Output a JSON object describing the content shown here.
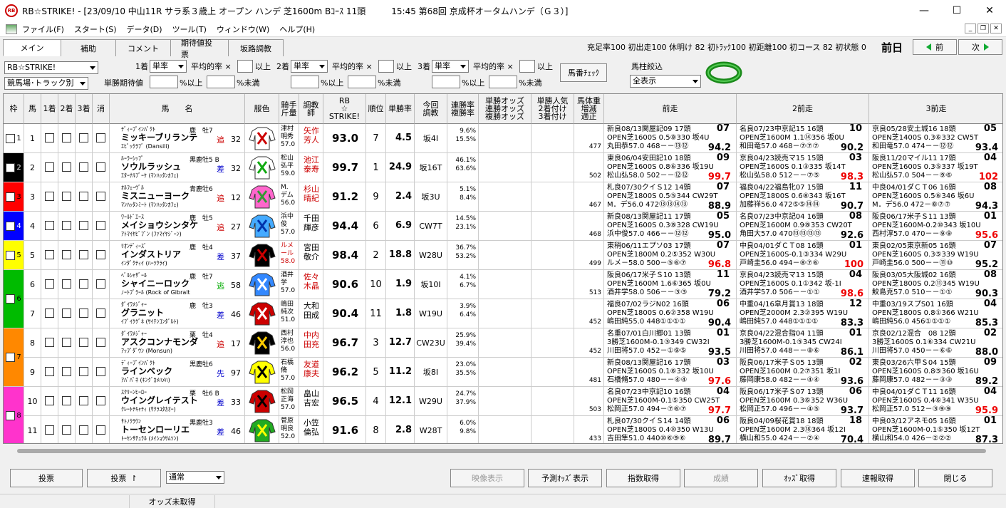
{
  "window": {
    "title": "RB☆STRIKE! - [23/09/10 中山11R サラ系３歳上 オープン ハンデ 芝1600m Bｺｰｽ 11頭　　　15:45 第68回 京成杯オータムハンデ（Ｇ３）]",
    "icon_text": "RB"
  },
  "menu": [
    "ファイル(F)",
    "スタート(S)",
    "データ(D)",
    "ツール(T)",
    "ウィンドウ(W)",
    "ヘルプ(H)"
  ],
  "tabs": [
    "メイン",
    "補助",
    "コメント",
    "期待値投票",
    "坂路調教"
  ],
  "stats": "充足率100 初出走100 休明け 82 初ﾄﾗｯｸ100 初距離100 初コース 82 初状態  0",
  "nav": {
    "day": "前日",
    "prev": "前",
    "next": "次"
  },
  "filters": {
    "app_select": "RB☆STRIKE!",
    "track_select": "競馬場･トラック別",
    "place1": "1着",
    "place2": "2着",
    "place3": "3着",
    "type": "単率",
    "avg": "平均的率 ×",
    "above": "以上",
    "expect": "単勝期待値",
    "pct_above": "%以上",
    "pct_below": "%未満",
    "umaban_btn": "馬番ﾁｪｯｸ",
    "filter_label": "馬柱絞込",
    "filter_value": "全表示"
  },
  "headers": {
    "waku": "枠",
    "uma": "馬",
    "p1": "1着",
    "p2": "2着",
    "p3": "3着",
    "del": "消",
    "name": "馬　　名",
    "silks": "服色",
    "jockey": "騎手\n斤量",
    "trainer": "調教\n師",
    "rb": "RB\n☆\nSTRIKE!",
    "rank": "順位",
    "win": "単勝率",
    "training": "今回\n調教",
    "rate": "連勝率\n複勝率",
    "odds": "単勝オッズ\n連勝オッズ\n複勝オッズ",
    "pop": "単勝人気\n2着付け\n3着付け",
    "weight": "馬体重\n増減\n適正",
    "r1": "前走",
    "r2": "2前走",
    "r3": "3前走"
  },
  "horses": [
    {
      "waku": "1",
      "num": "1",
      "sire": "ﾃﾞｨｰﾌﾟｲﾝﾊﾟｸﾄ",
      "sexage": "鹿　牡7",
      "name": "ミッキーブリランテ",
      "dam": "ｴﾋﾟｯｸﾗﾌﾞ (Dansili)",
      "style": "追",
      "pts": "32",
      "jockey": "津村\n明秀\n57.0",
      "trainer": "矢作\n芳人",
      "rb": "93.0",
      "rank": "7",
      "win": "4.5",
      "train": "坂4I",
      "r1": "9.6%",
      "r2": "15.5%",
      "w": "477",
      "races": [
        {
          "l1": "新良08/13関屋記09 17頭",
          "rk": "07",
          "l2": "OPEN芝1600S 0.5⑧330 坂4U",
          "l3": "丸田恭57.0 468－－⑬⑫",
          "ix": "94.2",
          "red": false
        },
        {
          "l1": "名良07/23中京記15 16頭",
          "rk": "10",
          "l2": "OPEN芝1600M 1.1⑭356 坂0U",
          "l3": "和田竜57.0 468－⑦⑦⑦",
          "ix": "90.2",
          "red": false
        },
        {
          "l1": "京良05/28安土城16 18頭",
          "rk": "05",
          "l2": "OPEN芝1400S 0.3⑥332 CW5T",
          "l3": "和田竜57.0 474－－⑫⑫",
          "ix": "93.4",
          "red": false
        }
      ]
    },
    {
      "waku": "2",
      "num": "2",
      "sire": "ﾙｰﾗｰｼｯﾌﾟ",
      "sexage": "黒鹿牡5 B",
      "name": "ソウルラッシュ",
      "dam": "ｴﾀｰﾅﾙﾌﾞｰｹ (ﾏﾝﾊｯﾀﾝｶﾌｪ)",
      "style": "差",
      "pts": "32",
      "jockey": "松山\n弘平\n59.0",
      "trainer": "池江\n泰寿",
      "rb": "99.7",
      "rank": "1",
      "win": "24.9",
      "train": "坂16T",
      "r1": "46.1%",
      "r2": "63.6%",
      "w": "502",
      "races": [
        {
          "l1": "東良06/04安田記10 18頭",
          "rk": "09",
          "l2": "OPEN芝1600S 0.8⑥336 坂19U",
          "l3": "松山弘58.0 502－－⑫⑫",
          "ix": "99.7",
          "red": true
        },
        {
          "l1": "京良04/23読売マ15 15頭",
          "rk": "03",
          "l2": "OPEN芝1600S 0.1③335 坂14T",
          "l3": "松山弘58.0 512－－⑦⑤",
          "ix": "98.3",
          "red": true
        },
        {
          "l1": "阪良11/20マイル11 17頭",
          "rk": "04",
          "l2": "OPEN芝1600S 0.3⑤337 坂19T",
          "l3": "松山弘57.0 504－－⑨⑥",
          "ix": "102",
          "red": true
        }
      ]
    },
    {
      "waku": "3",
      "num": "3",
      "sire": "ｵﾙﾌｪｰｳﾞﾙ",
      "sexage": "青鹿牡6",
      "name": "ミスニューヨーク",
      "dam": "ﾏﾝﾊｯﾀﾝﾐｰﾄ (ﾏﾝﾊｯﾀﾝｶﾌｪ)",
      "style": "追",
      "pts": "12",
      "jockey": "M.\nデム\n56.0",
      "trainer": "杉山\n晴紀",
      "rb": "91.2",
      "rank": "9",
      "win": "2.4",
      "train": "坂3U",
      "r1": "5.1%",
      "r2": "8.4%",
      "w": "467",
      "races": [
        {
          "l1": "札良07/30クイＳ12 14頭",
          "rk": "07",
          "l2": "OPEN芝1800S 0.5⑤344 CW29T",
          "l3": "M．デ56.0 472⑬⑬⑭⑬",
          "ix": "88.9",
          "red": false
        },
        {
          "l1": "福良04/22福島牝07 15頭",
          "rk": "11",
          "l2": "OPEN芝1800S 0.6⑧343 坂16T",
          "l3": "加藤祥56.0 472⑤⑤⑭⑭",
          "ix": "90.7",
          "red": false
        },
        {
          "l1": "中良04/01ダＣＴ06 16頭",
          "rk": "08",
          "l2": "OPEN芝1600S 0.5⑥346 坂6U",
          "l3": "M．デ56.0 472－⑧⑦⑦",
          "ix": "94.3",
          "red": false
        }
      ]
    },
    {
      "waku": "4",
      "num": "4",
      "sire": "ﾜｰﾙﾄﾞｴｰｽ",
      "sexage": "鹿　牡5",
      "name": "メイショウシンタケ",
      "dam": "ｱﾄﾏｲﾔﾋﾞﾌﾟﾝ (ﾌｧﾏｲﾔｼﾞｰﾝ)",
      "style": "追",
      "pts": "27",
      "jockey": "浜中\n俊\n57.0",
      "trainer": "千田\n輝彦",
      "rb": "94.4",
      "rank": "6",
      "win": "6.9",
      "train": "CW7T",
      "r1": "14.5%",
      "r2": "23.1%",
      "w": "468",
      "races": [
        {
          "l1": "新良08/13関屋記11 17頭",
          "rk": "05",
          "l2": "OPEN芝1600S 0.3⑧328 CW19U",
          "l3": "浜中俊57.0 466－－⑫⑫",
          "ix": "95.0",
          "red": false
        },
        {
          "l1": "名良07/23中京記04 16頭",
          "rk": "08",
          "l2": "OPEN芝1600M 0.9⑧353 CW20T",
          "l3": "角田大57.0 470⑬⑬⑬⑬",
          "ix": "92.6",
          "red": false
        },
        {
          "l1": "阪良06/17米子Ｓ11 13頭",
          "rk": "01",
          "l2": "OPEN芝1600M-0.2⑩343 坂10U",
          "l3": "西村淳57.0 470－－⑨⑨",
          "ix": "95.6",
          "red": true
        }
      ]
    },
    {
      "waku": "5",
      "num": "5",
      "sire": "ﾘｵﾝﾃﾞｨｰｽﾞ",
      "sexage": "鹿　牡4",
      "name": "インダストリア",
      "dam": "ｲﾝﾀﾞｸﾃｨｲ (ﾊｰﾂｸﾗｲ)",
      "style": "差",
      "pts": "37",
      "jockey": "ルメ\nール\n58.0",
      "trainer": "宮田\n敬介",
      "rb": "98.4",
      "rank": "2",
      "win": "18.8",
      "train": "W28U",
      "r1": "36.7%",
      "r2": "53.2%",
      "w": "499",
      "races": [
        {
          "l1": "東稍06/11エプソ03 17頭",
          "rk": "07",
          "l2": "OPEN芝1800M 0.2⑤352 W30U",
          "l3": "ルメ－58.0 500－⑤⑥⑦",
          "ix": "96.8",
          "red": true
        },
        {
          "l1": "中良04/01ダＣＴ08 16頭",
          "rk": "01",
          "l2": "OPEN芝1600S-0.1③334 W29U",
          "l3": "戸崎圭56.0 494－⑧⑦⑥",
          "ix": "100",
          "red": true
        },
        {
          "l1": "東良02/05東京新05 16頭",
          "rk": "07",
          "l2": "OPEN芝1600S 0.3⑤339 W19U",
          "l3": "戸崎圭56.0 500－－⑪⑩",
          "ix": "95.2",
          "red": false
        }
      ]
    },
    {
      "waku": "6",
      "num": "6",
      "sire": "ﾍﾞﾙｼｬｻﾞｰﾙ",
      "sexage": "鹿　牡7",
      "name": "シャイニーロック",
      "dam": "ﾉｰﾄﾌﾞﾗｰﾙ (Rock of Gibralt",
      "style": "逃",
      "pts": "58",
      "jockey": "酒井\n学\n57.0",
      "trainer": "佐々\n木晶",
      "rb": "90.6",
      "rank": "10",
      "win": "1.9",
      "train": "坂10I",
      "r1": "4.1%",
      "r2": "6.7%",
      "w": "513",
      "races": [
        {
          "l1": "阪良06/17米子Ｓ10 13頭",
          "rk": "11",
          "l2": "OPEN芝1600M 1.6⑥365 坂0U",
          "l3": "酒井学58.0 506－－③③",
          "ix": "79.2",
          "red": false
        },
        {
          "l1": "京良04/23読売マ13 15頭",
          "rk": "04",
          "l2": "OPEN芝1600S 0.1①342 坂-1I",
          "l3": "酒井学57.0 506－－①①",
          "ix": "98.6",
          "red": true
        },
        {
          "l1": "阪良03/05大阪城02 16頭",
          "rk": "08",
          "l2": "OPEN芝1800S 0.2⑪345 W19U",
          "l3": "鮫島克57.0 510－－①①",
          "ix": "90.3",
          "red": false
        }
      ]
    },
    {
      "waku": "6",
      "num": "7",
      "sire": "ﾀﾞｲﾜﾒｼﾞｬｰ",
      "sexage": "鹿　牡3",
      "name": "グラニット",
      "dam": "ｲﾌﾞｲｸｸﾞﾈ (ｻｲﾁﾝｺﾝﾀﾞﾙﾄ)",
      "style": "差",
      "pts": "46",
      "jockey": "嶋田\n純次\n51.0",
      "trainer": "大和\n田成",
      "rb": "90.4",
      "rank": "11",
      "win": "1.8",
      "train": "W19U",
      "r1": "3.9%",
      "r2": "6.4%",
      "w": "452",
      "races": [
        {
          "l1": "福良07/02ラジN02 16頭",
          "rk": "06",
          "l2": "OPEN芝1800S 0.6②358 W19U",
          "l3": "嶋田純55.0 448①①①①",
          "ix": "90.4",
          "red": false
        },
        {
          "l1": "中重04/16皐月賞13 18頭",
          "rk": "12",
          "l2": "OPEN芝2000M 2.3②395 W19U",
          "l3": "嶋田純57.0 448①①①①",
          "ix": "83.3",
          "red": false
        },
        {
          "l1": "中重03/19スプS01 16頭",
          "rk": "04",
          "l2": "OPEN芝1800S 0.8①366 W21U",
          "l3": "嶋田純56.0 456①①①①",
          "ix": "85.3",
          "red": false
        }
      ]
    },
    {
      "waku": "7",
      "num": "8",
      "sire": "ﾀﾞｲﾜﾒｼﾞｬｰ",
      "sexage": "栗　牡4",
      "name": "アスクコンナモンダ",
      "dam": "ｱｯﾌﾟﾀﾞｳﾝ (Monsun)",
      "style": "追",
      "pts": "17",
      "jockey": "西村\n淳也\n56.0",
      "trainer": "中内\n田充",
      "rb": "96.7",
      "rank": "3",
      "win": "12.7",
      "train": "CW23U",
      "r1": "25.9%",
      "r2": "39.4%",
      "w": "452",
      "races": [
        {
          "l1": "名重07/01白川郷01 13頭",
          "rk": "01",
          "l2": "3勝芝1600M-0.1③349 CW32I",
          "l3": "川田将57.0 452－①⑨⑤",
          "ix": "93.5",
          "red": false
        },
        {
          "l1": "京良04/22混合指04 11頭",
          "rk": "01",
          "l2": "3勝芝1600M-0.1⑤345 CW24I",
          "l3": "川田将57.0 448－－⑧⑥",
          "ix": "86.1",
          "red": false
        },
        {
          "l1": "京良02/12混合　08 12頭",
          "rk": "02",
          "l2": "3勝芝1600S 0.1⑥334 CW21U",
          "l3": "川田将57.0 450－－⑥⑥",
          "ix": "88.0",
          "red": false
        }
      ]
    },
    {
      "waku": "7",
      "num": "9",
      "sire": "ﾃﾞｨｰﾌﾟｲﾝﾊﾟｸﾄ",
      "sexage": "黒鹿牡6",
      "name": "ラインベック",
      "dam": "ｱﾊﾟﾊﾟﾈ (ｷﾝｸﾞｶﾒﾊﾒﾊ)",
      "style": "先",
      "pts": "97",
      "jockey": "石橋\n脩\n57.0",
      "trainer": "友道\n康夫",
      "rb": "96.2",
      "rank": "5",
      "win": "11.2",
      "train": "坂8I",
      "r1": "23.0%",
      "r2": "35.5%",
      "w": "481",
      "races": [
        {
          "l1": "新良08/13関屋記16 17頭",
          "rk": "03",
          "l2": "OPEN芝1600S 0.1⑥332 坂10U",
          "l3": "石橋脩57.0 480－－④④",
          "ix": "97.6",
          "red": true
        },
        {
          "l1": "阪良06/17米子Ｓ05 13頭",
          "rk": "02",
          "l2": "OPEN芝1600M 0.2⑦351 坂1I",
          "l3": "藤岡康58.0 482－－④④",
          "ix": "93.6",
          "red": false
        },
        {
          "l1": "東良03/26六甲Ｓ04 15頭",
          "rk": "09",
          "l2": "OPEN芝1600S 0.8⑤360 坂16U",
          "l3": "藤岡康57.0 482－－③③",
          "ix": "89.2",
          "red": false
        }
      ]
    },
    {
      "waku": "8",
      "num": "10",
      "sire": "ｽｸﾘｰﾝﾋｰﾛｰ",
      "sexage": "栗　牡6 B",
      "name": "ウイングレイテスト",
      "dam": "ｸﾚｰﾄﾃｷｬﾃｨ (ｻｸﾗﾕﾀｶｵｰ)",
      "style": "差",
      "pts": "33",
      "jockey": "松岡\n正海\n57.0",
      "trainer": "畠山\n吉宏",
      "rb": "96.5",
      "rank": "4",
      "win": "12.1",
      "train": "W29U",
      "r1": "24.7%",
      "r2": "37.9%",
      "w": "503",
      "races": [
        {
          "l1": "名良07/23中京記10 16頭",
          "rk": "04",
          "l2": "OPEN芝1600M-0.1⑤350 CW25T",
          "l3": "松岡正57.0 494－⑦⑥⑦",
          "ix": "97.7",
          "red": true
        },
        {
          "l1": "阪良06/17米子Ｓ07 13頭",
          "rk": "06",
          "l2": "OPEN芝1600M 0.3⑥352 W36U",
          "l3": "松岡正57.0 496－－④⑤",
          "ix": "93.7",
          "red": false
        },
        {
          "l1": "中良04/01ダＣＴ11 16頭",
          "rk": "04",
          "l2": "OPEN芝1600S 0.4⑥341 W35U",
          "l3": "松岡正57.0 512－③⑨⑨",
          "ix": "95.9",
          "red": true
        }
      ]
    },
    {
      "waku": "8",
      "num": "11",
      "sire": "ｻﾄﾉｸﾗｳﾝ",
      "sexage": "黒鹿牡3",
      "name": "トーセンローリエ",
      "dam": "ﾄｰｾﾝｻﾁｭﾗﾙ (ﾒｲｼｮｳｻﾑｿﾝ)",
      "style": "差",
      "pts": "46",
      "jockey": "菅原\n明良\n52.0",
      "trainer": "小笠\n倫弘",
      "rb": "91.6",
      "rank": "8",
      "win": "2.8",
      "train": "W28T",
      "r1": "6.0%",
      "r2": "9.8%",
      "w": "433",
      "races": [
        {
          "l1": "札良07/30クイＳ14 14頭",
          "rk": "06",
          "l2": "OPEN芝1800S 0.4⑩350 W13U",
          "l3": "吉田隼51.0 440⑩⑥⑨⑥",
          "ix": "89.7",
          "red": false
        },
        {
          "l1": "阪良04/09桜花賞18 18頭",
          "rk": "18",
          "l2": "OPEN芝1600M 2.3⑱364 坂12I",
          "l3": "横山和55.0 424－－②④",
          "ix": "70.4",
          "red": false
        },
        {
          "l1": "中良03/12アネモ05 16頭",
          "rk": "01",
          "l2": "OPEN芝1600M-0.1⑤350 坂12T",
          "l3": "横山和54.0 426－②②②",
          "ix": "87.3",
          "red": false
        }
      ]
    }
  ],
  "waku_colors": {
    "1": "#ffffff",
    "2": "#000000",
    "3": "#ff0000",
    "4": "#0000ff",
    "5": "#ffff00",
    "6": "#00bb00",
    "7": "#ff8800",
    "8": "#ff33cc"
  },
  "bottom": {
    "vote": "投票",
    "vote2": "投票",
    "mode": "通常",
    "video": "映像表示",
    "pred": "予測ｵｯｽﾞ表示",
    "index": "指数取得",
    "result": "成績",
    "odds": "ｵｯｽﾞ取得",
    "flash": "速報取得",
    "close": "閉じる"
  },
  "status": "オッズ未取得"
}
